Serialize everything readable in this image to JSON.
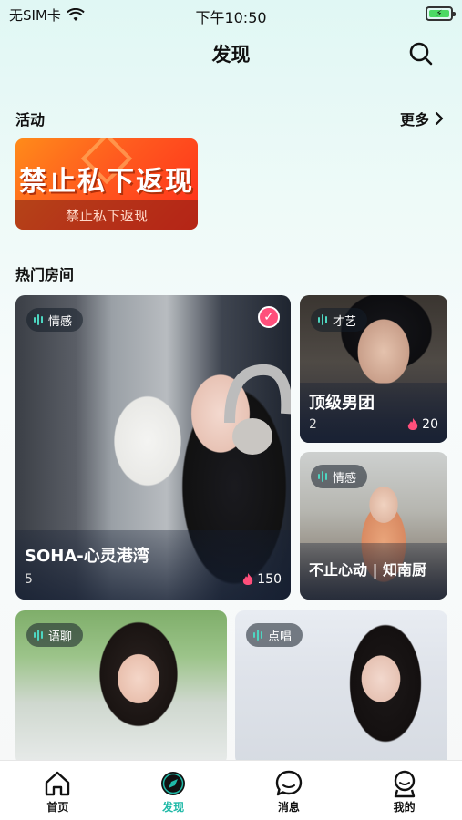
{
  "status_bar": {
    "carrier": "无SIM卡",
    "time": "下午10:50"
  },
  "nav": {
    "title": "发现"
  },
  "activity": {
    "heading": "活动",
    "more_label": "更多",
    "banner": {
      "headline": "禁止私下返现",
      "caption": "禁止私下返现"
    }
  },
  "hot_rooms": {
    "heading": "热门房间",
    "rooms": [
      {
        "tag": "情感",
        "name": "SOHA-心灵港湾",
        "count": "5",
        "heat": "150"
      },
      {
        "tag": "才艺",
        "name": "顶级男团",
        "count": "2",
        "heat": "20"
      },
      {
        "tag": "情感",
        "name": "不止心动 | 知南厨"
      },
      {
        "tag": "语聊"
      },
      {
        "tag": "点唱"
      }
    ]
  },
  "tabbar": {
    "items": [
      {
        "label": "首页"
      },
      {
        "label": "发现"
      },
      {
        "label": "消息"
      },
      {
        "label": "我的"
      }
    ]
  },
  "colors": {
    "accent": "#1fb9a7",
    "banner_orange": "#ff5a1f",
    "heat": "#ff4f7b"
  }
}
